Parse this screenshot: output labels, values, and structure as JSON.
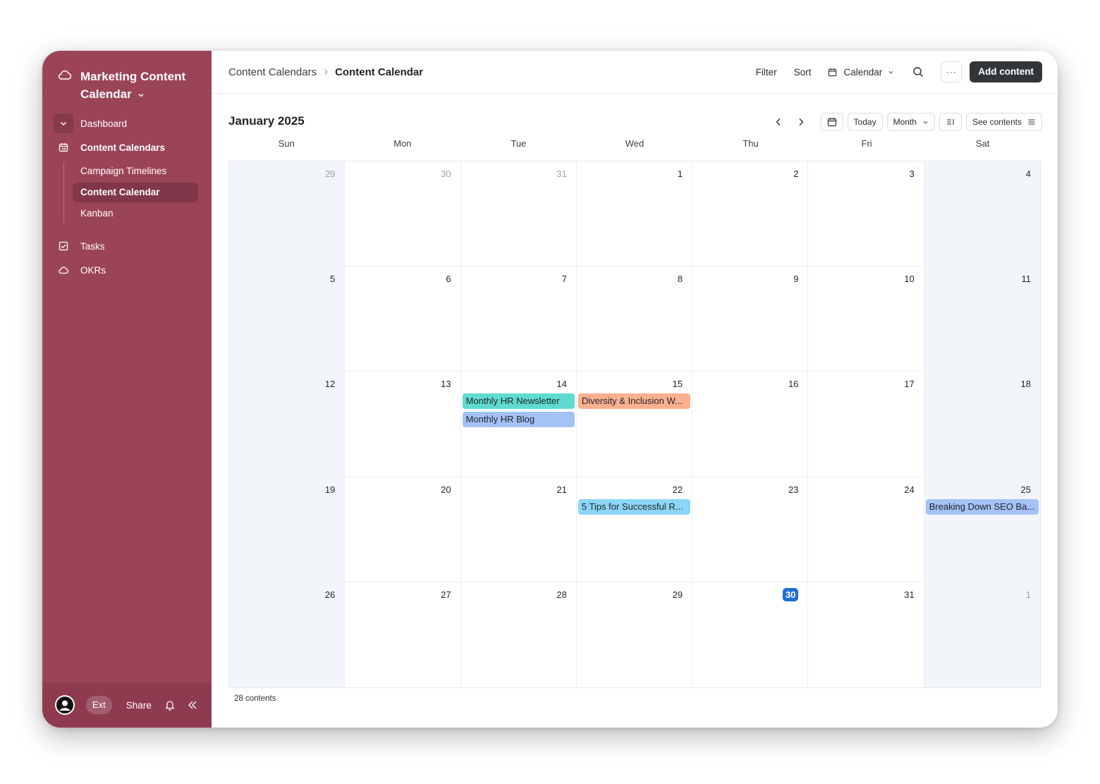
{
  "workspace": {
    "title": "Marketing Content Calendar"
  },
  "sidebar": {
    "items": [
      {
        "label": "Dashboard"
      },
      {
        "label": "Content Calendars"
      },
      {
        "label": "Tasks"
      },
      {
        "label": "OKRs"
      }
    ],
    "sub_items": [
      {
        "label": "Campaign Timelines"
      },
      {
        "label": "Content Calendar"
      },
      {
        "label": "Kanban"
      }
    ],
    "footer": {
      "ext_label": "Ext",
      "share_label": "Share"
    }
  },
  "breadcrumb": {
    "parent": "Content Calendars",
    "current": "Content Calendar"
  },
  "toolbar": {
    "filter_label": "Filter",
    "sort_label": "Sort",
    "view_label": "Calendar",
    "more_label": "···",
    "add_label": "Add content"
  },
  "calendar": {
    "month_title": "January 2025",
    "today_label": "Today",
    "view_mode": "Month",
    "see_contents_label": "See contents",
    "weekdays": [
      "Sun",
      "Mon",
      "Tue",
      "Wed",
      "Thu",
      "Fri",
      "Sat"
    ],
    "days": [
      {
        "n": "29",
        "muted": true
      },
      {
        "n": "30",
        "muted": true
      },
      {
        "n": "31",
        "muted": true
      },
      {
        "n": "1"
      },
      {
        "n": "2"
      },
      {
        "n": "3"
      },
      {
        "n": "4"
      },
      {
        "n": "5"
      },
      {
        "n": "6"
      },
      {
        "n": "7"
      },
      {
        "n": "8"
      },
      {
        "n": "9"
      },
      {
        "n": "10"
      },
      {
        "n": "11"
      },
      {
        "n": "12"
      },
      {
        "n": "13"
      },
      {
        "n": "14",
        "events": [
          {
            "title": "Monthly HR Newsletter",
            "color": "#5fdccf"
          },
          {
            "title": "Monthly HR Blog",
            "color": "#a4c2f6"
          }
        ]
      },
      {
        "n": "15",
        "events": [
          {
            "title": "Diversity & Inclusion W...",
            "color": "#fbb08f"
          }
        ]
      },
      {
        "n": "16"
      },
      {
        "n": "17"
      },
      {
        "n": "18"
      },
      {
        "n": "19"
      },
      {
        "n": "20"
      },
      {
        "n": "21"
      },
      {
        "n": "22",
        "events": [
          {
            "title": "5 Tips for Successful R...",
            "color": "#8dd5f7"
          }
        ]
      },
      {
        "n": "23"
      },
      {
        "n": "24"
      },
      {
        "n": "25",
        "events": [
          {
            "title": "Breaking Down SEO Ba...",
            "color": "#a4c2f6"
          }
        ]
      },
      {
        "n": "26"
      },
      {
        "n": "27"
      },
      {
        "n": "28"
      },
      {
        "n": "29"
      },
      {
        "n": "30",
        "today": true
      },
      {
        "n": "31"
      },
      {
        "n": "1",
        "muted": true
      }
    ]
  },
  "footer": {
    "count_text": "28 contents"
  },
  "colors": {
    "sidebar": "#9c4457",
    "today": "#1f6fd6",
    "weekend": "#f2f6fb",
    "primary_button": "#32363b"
  }
}
